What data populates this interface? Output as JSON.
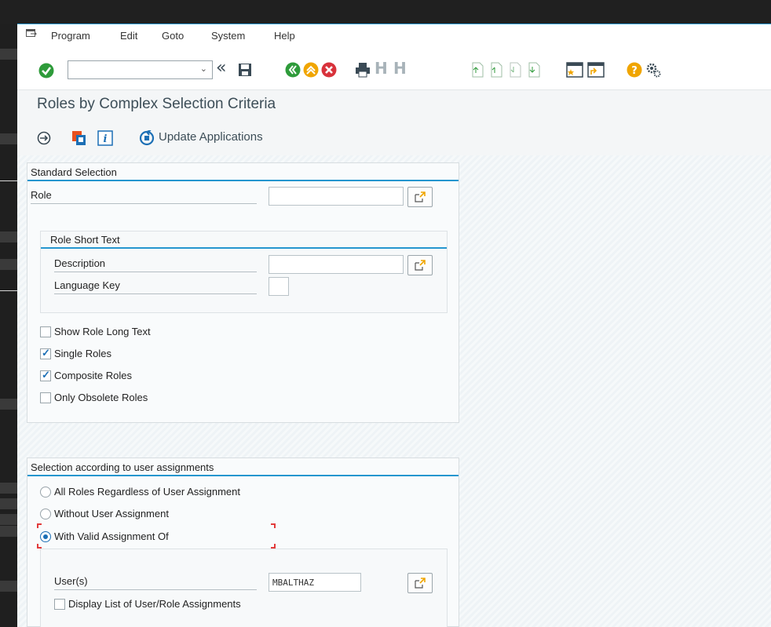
{
  "menu": {
    "items": [
      "Program",
      "Edit",
      "Goto",
      "System",
      "Help"
    ]
  },
  "toolbar": {
    "command_value": "",
    "icons": [
      "enter-icon",
      "back-icon",
      "save-icon",
      "back-nav-icon",
      "exit-icon",
      "cancel-icon",
      "print-icon",
      "find-icon",
      "find-next-icon",
      "first-page-icon",
      "prev-page-icon",
      "next-page-icon",
      "last-page-icon",
      "new-session-icon",
      "shortcut-icon",
      "help-icon",
      "settings-icon"
    ]
  },
  "page": {
    "title": "Roles by Complex Selection Criteria"
  },
  "app_toolbar": {
    "update_label": "Update Applications"
  },
  "standard_selection": {
    "title": "Standard Selection",
    "role_label": "Role",
    "role_value": "",
    "short_text": {
      "title": "Role Short Text",
      "description_label": "Description",
      "description_value": "",
      "language_label": "Language Key",
      "language_value": ""
    },
    "checkboxes": [
      {
        "label": "Show Role Long Text",
        "checked": false
      },
      {
        "label": "Single Roles",
        "checked": true
      },
      {
        "label": "Composite Roles",
        "checked": true
      },
      {
        "label": "Only Obsolete Roles",
        "checked": false
      }
    ]
  },
  "user_assignment": {
    "title": "Selection according to user assignments",
    "radios": [
      {
        "label": "All Roles Regardless of User Assignment",
        "selected": false
      },
      {
        "label": "Without User Assignment",
        "selected": false
      },
      {
        "label": "With Valid Assignment Of",
        "selected": true
      }
    ],
    "users_label": "User(s)",
    "users_value": "MBALTHAZ",
    "display_list_label": "Display List of User/Role Assignments",
    "display_list_checked": false
  },
  "colors": {
    "accent": "#2596cf",
    "title": "#3d4e58",
    "green": "#2e9b3a",
    "orange": "#f0a500",
    "red": "#d8323b"
  }
}
